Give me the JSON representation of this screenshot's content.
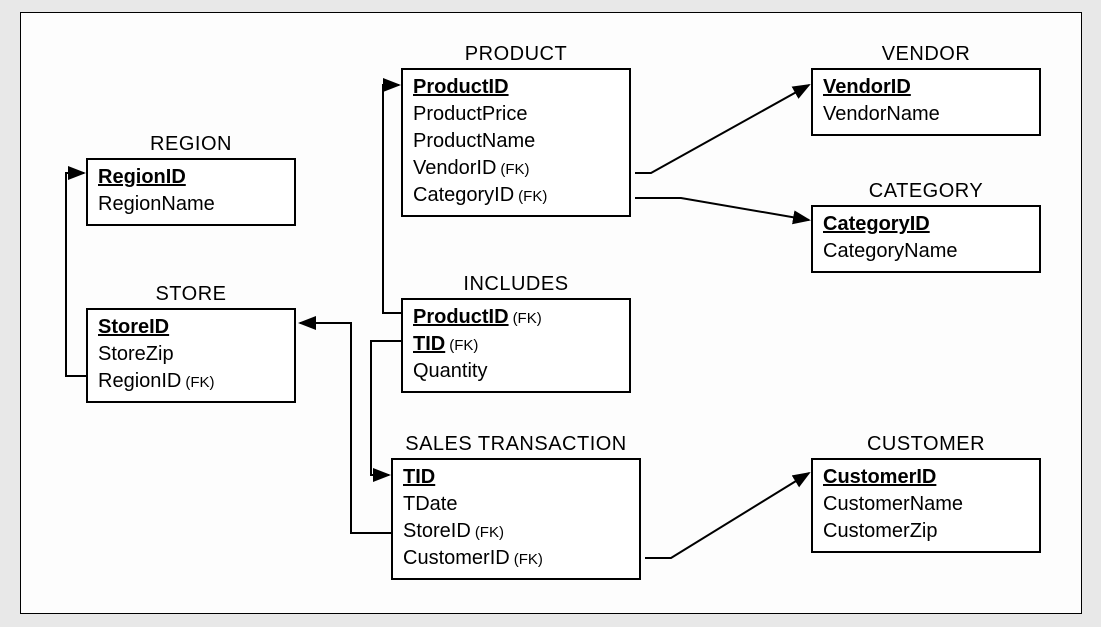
{
  "fk_label": "(FK)",
  "entities": {
    "region": {
      "title": "REGION",
      "attrs": [
        {
          "name": "RegionID",
          "pk": true,
          "fk": false
        },
        {
          "name": "RegionName",
          "pk": false,
          "fk": false
        }
      ]
    },
    "store": {
      "title": "STORE",
      "attrs": [
        {
          "name": "StoreID",
          "pk": true,
          "fk": false
        },
        {
          "name": "StoreZip",
          "pk": false,
          "fk": false
        },
        {
          "name": "RegionID",
          "pk": false,
          "fk": true
        }
      ]
    },
    "product": {
      "title": "PRODUCT",
      "attrs": [
        {
          "name": "ProductID",
          "pk": true,
          "fk": false
        },
        {
          "name": "ProductPrice",
          "pk": false,
          "fk": false
        },
        {
          "name": "ProductName",
          "pk": false,
          "fk": false
        },
        {
          "name": "VendorID",
          "pk": false,
          "fk": true
        },
        {
          "name": "CategoryID",
          "pk": false,
          "fk": true
        }
      ]
    },
    "includes": {
      "title": "INCLUDES",
      "attrs": [
        {
          "name": "ProductID",
          "pk": true,
          "fk": true
        },
        {
          "name": "TID",
          "pk": true,
          "fk": true
        },
        {
          "name": "Quantity",
          "pk": false,
          "fk": false
        }
      ]
    },
    "sales": {
      "title": "SALES TRANSACTION",
      "attrs": [
        {
          "name": "TID",
          "pk": true,
          "fk": false
        },
        {
          "name": "TDate",
          "pk": false,
          "fk": false
        },
        {
          "name": "StoreID",
          "pk": false,
          "fk": true
        },
        {
          "name": "CustomerID",
          "pk": false,
          "fk": true
        }
      ]
    },
    "vendor": {
      "title": "VENDOR",
      "attrs": [
        {
          "name": "VendorID",
          "pk": true,
          "fk": false
        },
        {
          "name": "VendorName",
          "pk": false,
          "fk": false
        }
      ]
    },
    "category": {
      "title": "CATEGORY",
      "attrs": [
        {
          "name": "CategoryID",
          "pk": true,
          "fk": false
        },
        {
          "name": "CategoryName",
          "pk": false,
          "fk": false
        }
      ]
    },
    "customer": {
      "title": "CUSTOMER",
      "attrs": [
        {
          "name": "CustomerID",
          "pk": true,
          "fk": false
        },
        {
          "name": "CustomerName",
          "pk": false,
          "fk": false
        },
        {
          "name": "CustomerZip",
          "pk": false,
          "fk": false
        }
      ]
    }
  }
}
